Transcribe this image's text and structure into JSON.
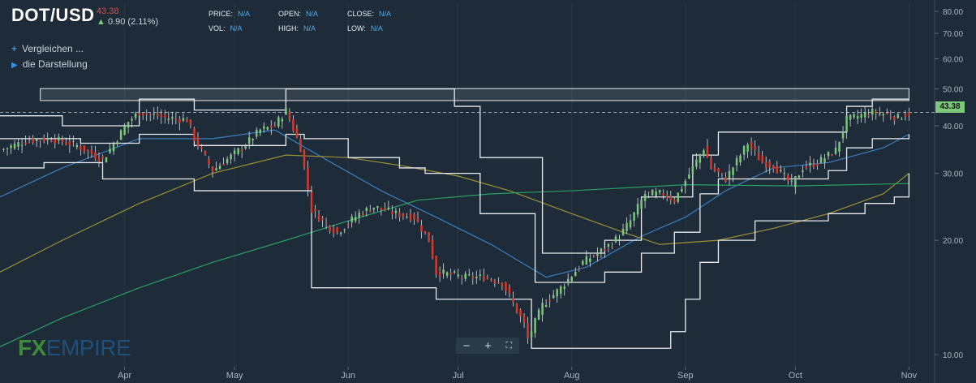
{
  "header": {
    "symbol": "DOT/USD",
    "last_price": "43.38",
    "change": "0.90 (2.11%)",
    "change_icon": "arrow-up-icon",
    "price_label": "PRICE:",
    "price_value": "N/A",
    "open_label": "OPEN:",
    "open_value": "N/A",
    "close_label": "CLOSE:",
    "close_value": "N/A",
    "vol_label": "VOL:",
    "vol_value": "N/A",
    "high_label": "HIGH:",
    "high_value": "N/A",
    "low_label": "LOW:",
    "low_value": "N/A"
  },
  "menu": {
    "compare_label": "Vergleichen ...",
    "compare_icon": "plus-icon",
    "display_label": "die Darstellung",
    "display_icon": "play-icon"
  },
  "zoom": {
    "minus": "−",
    "plus": "+",
    "fullscreen": "⛶"
  },
  "logo": {
    "fx": "FX",
    "rest": "EMPIRE"
  },
  "price_tag": "43.38",
  "colors": {
    "up": "#7cc77a",
    "down": "#d63a2a",
    "background": "#1e2b38"
  },
  "chart_data": {
    "type": "candlestick",
    "title": "DOT/USD",
    "y_scale": "log",
    "ylim": [
      9.3,
      84
    ],
    "y_ticks": [
      "80.00",
      "70.00",
      "60.00",
      "50.00",
      "40.00",
      "30.00",
      "20.00",
      "10.00"
    ],
    "y_tick_values": [
      80,
      70,
      60,
      50,
      40,
      30,
      20,
      10
    ],
    "x_ticks": [
      "Apr",
      "May",
      "Jun",
      "Jul",
      "Aug",
      "Sep",
      "Oct",
      "Nov"
    ],
    "x_tick_dates": [
      "2021-04-01",
      "2021-05-01",
      "2021-06-01",
      "2021-07-01",
      "2021-08-01",
      "2021-09-01",
      "2021-10-01",
      "2021-11-01"
    ],
    "x_range": [
      "2021-02-26",
      "2021-11-08"
    ],
    "current_price_line": 43.38,
    "resistance_zone": [
      {
        "x0": "2021-03-09",
        "x1": "2021-11-01",
        "y0": 46.6,
        "y1": 50.1
      }
    ],
    "close_anchors": [
      [
        "2021-02-26",
        34.5
      ],
      [
        "2021-03-05",
        36.5
      ],
      [
        "2021-03-12",
        37.0
      ],
      [
        "2021-03-19",
        35.5
      ],
      [
        "2021-03-26",
        32.5
      ],
      [
        "2021-04-02",
        41.0
      ],
      [
        "2021-04-05",
        43.5
      ],
      [
        "2021-04-12",
        42.0
      ],
      [
        "2021-04-18",
        41.5
      ],
      [
        "2021-04-20",
        37.0
      ],
      [
        "2021-04-25",
        30.5
      ],
      [
        "2021-05-03",
        35.0
      ],
      [
        "2021-05-08",
        39.0
      ],
      [
        "2021-05-12",
        40.0
      ],
      [
        "2021-05-15",
        44.0
      ],
      [
        "2021-05-19",
        35.0
      ],
      [
        "2021-05-22",
        24.0
      ],
      [
        "2021-05-26",
        22.0
      ],
      [
        "2021-05-29",
        21.0
      ],
      [
        "2021-06-04",
        23.5
      ],
      [
        "2021-06-08",
        24.5
      ],
      [
        "2021-06-14",
        23.5
      ],
      [
        "2021-06-19",
        23.0
      ],
      [
        "2021-06-23",
        20.0
      ],
      [
        "2021-06-25",
        16.5
      ],
      [
        "2021-07-03",
        16.0
      ],
      [
        "2021-07-08",
        16.0
      ],
      [
        "2021-07-13",
        15.5
      ],
      [
        "2021-07-19",
        12.0
      ],
      [
        "2021-07-20",
        11.0
      ],
      [
        "2021-07-24",
        13.5
      ],
      [
        "2021-07-29",
        15.0
      ],
      [
        "2021-08-04",
        17.5
      ],
      [
        "2021-08-10",
        19.0
      ],
      [
        "2021-08-14",
        20.5
      ],
      [
        "2021-08-17",
        22.5
      ],
      [
        "2021-08-21",
        26.5
      ],
      [
        "2021-08-26",
        26.5
      ],
      [
        "2021-08-29",
        25.5
      ],
      [
        "2021-09-03",
        31.0
      ],
      [
        "2021-09-06",
        35.0
      ],
      [
        "2021-09-08",
        31.0
      ],
      [
        "2021-09-12",
        29.0
      ],
      [
        "2021-09-18",
        36.0
      ],
      [
        "2021-09-22",
        32.0
      ],
      [
        "2021-09-25",
        31.5
      ],
      [
        "2021-09-30",
        28.0
      ],
      [
        "2021-10-03",
        31.0
      ],
      [
        "2021-10-07",
        32.0
      ],
      [
        "2021-10-12",
        34.5
      ],
      [
        "2021-10-15",
        41.5
      ],
      [
        "2021-10-22",
        43.5
      ],
      [
        "2021-10-25",
        43.0
      ],
      [
        "2021-10-29",
        42.0
      ],
      [
        "2021-11-01",
        43.38
      ]
    ],
    "series": [
      {
        "style": "line",
        "color": "#3a7fc0",
        "points": [
          [
            "2021-02-26",
            26.0
          ],
          [
            "2021-03-15",
            31.0
          ],
          [
            "2021-04-05",
            37.0
          ],
          [
            "2021-04-25",
            37.0
          ],
          [
            "2021-05-12",
            39.0
          ],
          [
            "2021-05-25",
            33.0
          ],
          [
            "2021-06-10",
            27.0
          ],
          [
            "2021-06-25",
            23.0
          ],
          [
            "2021-07-10",
            19.5
          ],
          [
            "2021-07-25",
            16.0
          ],
          [
            "2021-08-05",
            17.0
          ],
          [
            "2021-08-20",
            20.5
          ],
          [
            "2021-09-01",
            23.0
          ],
          [
            "2021-09-12",
            27.0
          ],
          [
            "2021-09-25",
            31.0
          ],
          [
            "2021-10-10",
            32.0
          ],
          [
            "2021-10-25",
            35.0
          ],
          [
            "2021-11-01",
            38.0
          ]
        ]
      },
      {
        "style": "line",
        "color": "#9a9236",
        "points": [
          [
            "2021-02-26",
            16.5
          ],
          [
            "2021-03-15",
            20.0
          ],
          [
            "2021-04-05",
            25.0
          ],
          [
            "2021-04-25",
            30.0
          ],
          [
            "2021-05-15",
            33.5
          ],
          [
            "2021-06-01",
            33.0
          ],
          [
            "2021-06-15",
            31.5
          ],
          [
            "2021-07-01",
            29.5
          ],
          [
            "2021-07-15",
            27.0
          ],
          [
            "2021-08-01",
            23.5
          ],
          [
            "2021-08-15",
            21.0
          ],
          [
            "2021-08-25",
            19.5
          ],
          [
            "2021-09-10",
            20.0
          ],
          [
            "2021-09-25",
            21.5
          ],
          [
            "2021-10-10",
            23.5
          ],
          [
            "2021-10-25",
            26.5
          ],
          [
            "2021-11-01",
            30.0
          ]
        ]
      },
      {
        "style": "line",
        "color": "#2aa065",
        "points": [
          [
            "2021-02-26",
            10.5
          ],
          [
            "2021-03-15",
            12.5
          ],
          [
            "2021-04-05",
            15.0
          ],
          [
            "2021-04-25",
            17.5
          ],
          [
            "2021-05-15",
            20.0
          ],
          [
            "2021-06-01",
            22.5
          ],
          [
            "2021-06-20",
            25.5
          ],
          [
            "2021-07-10",
            26.5
          ],
          [
            "2021-08-01",
            27.0
          ],
          [
            "2021-09-01",
            28.0
          ],
          [
            "2021-10-01",
            27.8
          ],
          [
            "2021-11-01",
            28.2
          ]
        ]
      },
      {
        "style": "step",
        "color": "#e8ecef",
        "points": [
          [
            "2021-02-26",
            42.5
          ],
          [
            "2021-03-10",
            42.5
          ],
          [
            "2021-03-15",
            40.0
          ],
          [
            "2021-04-01",
            40.0
          ],
          [
            "2021-04-05",
            47.0
          ],
          [
            "2021-04-18",
            47.0
          ],
          [
            "2021-04-20",
            44.0
          ],
          [
            "2021-05-10",
            44.0
          ],
          [
            "2021-05-15",
            50.0
          ],
          [
            "2021-06-27",
            50.0
          ],
          [
            "2021-06-30",
            45.0
          ],
          [
            "2021-07-07",
            33.0
          ],
          [
            "2021-07-20",
            33.0
          ],
          [
            "2021-07-24",
            18.5
          ],
          [
            "2021-08-03",
            18.5
          ],
          [
            "2021-08-10",
            20.0
          ],
          [
            "2021-08-20",
            26.0
          ],
          [
            "2021-08-29",
            26.0
          ],
          [
            "2021-09-03",
            33.5
          ],
          [
            "2021-09-10",
            38.5
          ],
          [
            "2021-10-11",
            38.5
          ],
          [
            "2021-10-15",
            45.0
          ],
          [
            "2021-10-22",
            47.0
          ],
          [
            "2021-11-01",
            47.0
          ]
        ]
      },
      {
        "style": "step",
        "color": "#e8ecef",
        "points": [
          [
            "2021-02-26",
            31.0
          ],
          [
            "2021-03-10",
            32.0
          ],
          [
            "2021-03-26",
            29.0
          ],
          [
            "2021-04-18",
            29.0
          ],
          [
            "2021-04-20",
            27.0
          ],
          [
            "2021-05-20",
            27.0
          ],
          [
            "2021-05-22",
            15.0
          ],
          [
            "2021-06-23",
            15.0
          ],
          [
            "2021-06-25",
            14.0
          ],
          [
            "2021-07-20",
            14.0
          ],
          [
            "2021-07-21",
            10.4
          ],
          [
            "2021-08-24",
            10.4
          ],
          [
            "2021-08-28",
            11.5
          ],
          [
            "2021-09-01",
            14.0
          ],
          [
            "2021-09-05",
            17.5
          ],
          [
            "2021-09-10",
            20.0
          ],
          [
            "2021-09-20",
            22.5
          ],
          [
            "2021-10-10",
            23.5
          ],
          [
            "2021-10-20",
            25.0
          ],
          [
            "2021-10-28",
            26.0
          ],
          [
            "2021-11-01",
            30.0
          ]
        ]
      },
      {
        "style": "step",
        "color": "#e8ecef",
        "points": [
          [
            "2021-02-26",
            37.0
          ],
          [
            "2021-03-10",
            37.0
          ],
          [
            "2021-03-20",
            36.0
          ],
          [
            "2021-04-05",
            38.0
          ],
          [
            "2021-04-18",
            38.0
          ],
          [
            "2021-04-20",
            35.5
          ],
          [
            "2021-05-15",
            38.0
          ],
          [
            "2021-05-20",
            37.0
          ],
          [
            "2021-06-01",
            33.0
          ],
          [
            "2021-06-15",
            31.0
          ],
          [
            "2021-06-22",
            30.0
          ],
          [
            "2021-07-07",
            23.5
          ],
          [
            "2021-07-20",
            23.5
          ],
          [
            "2021-07-22",
            15.5
          ],
          [
            "2021-08-03",
            15.5
          ],
          [
            "2021-08-10",
            16.5
          ],
          [
            "2021-08-20",
            18.5
          ],
          [
            "2021-08-29",
            21.0
          ],
          [
            "2021-09-05",
            26.5
          ],
          [
            "2021-09-10",
            29.0
          ],
          [
            "2021-09-30",
            29.0
          ],
          [
            "2021-10-10",
            30.5
          ],
          [
            "2021-10-15",
            35.0
          ],
          [
            "2021-10-22",
            37.0
          ],
          [
            "2021-11-01",
            38.0
          ]
        ]
      }
    ]
  }
}
